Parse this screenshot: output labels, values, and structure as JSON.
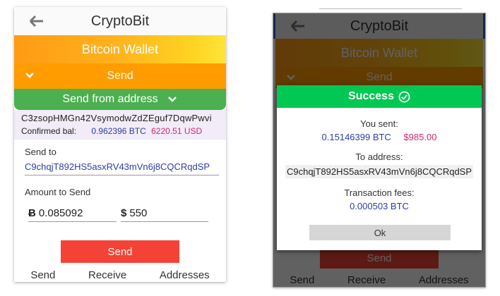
{
  "app": {
    "title": "CryptoBit",
    "wallet_title": "Bitcoin Wallet"
  },
  "send_screen": {
    "section_label": "Send",
    "from_label": "Send from address",
    "address": "C3zsopHMGn42VsymodwZdZEguf7DqwPwvi",
    "confirmed_label": "Confirmed bal:",
    "confirmed_btc": "0.962396 BTC",
    "confirmed_usd": "6220.51 USD",
    "send_to_label": "Send to",
    "send_to_value": "C9chqjT892HS5asxRV43mVn6j8CQCRqdSP",
    "amount_label": "Amount to Send",
    "btc_symbol": "Ƀ",
    "btc_amount": "0.085092",
    "usd_symbol": "$",
    "usd_amount": "550",
    "send_button": "Send"
  },
  "nav": {
    "send": "Send",
    "receive": "Receive",
    "addresses": "Addresses"
  },
  "success_dialog": {
    "title": "Success",
    "you_sent_label": "You sent:",
    "sent_btc": "0.15146399 BTC",
    "sent_usd": "$985.00",
    "to_address_label": "To address:",
    "to_address": "C9chqjT892HS5asxRV43mVn6j8CQCRqdSP",
    "fees_label": "Transaction fees:",
    "fees_value": "0.000503 BTC",
    "ok_button": "Ok"
  },
  "icons": {
    "back": "arrow-left-icon",
    "expand": "chevron-down-icon",
    "success": "check-circle-icon"
  },
  "colors": {
    "send_orange": "#ff9c00",
    "from_green": "#4caf50",
    "send_red": "#f44336",
    "success_green": "#00c853"
  }
}
